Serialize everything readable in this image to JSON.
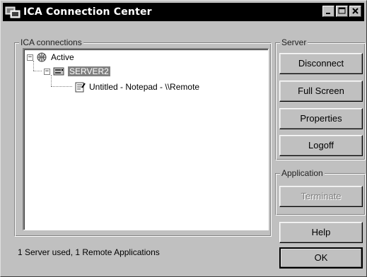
{
  "window": {
    "title": "ICA Connection Center",
    "controls": [
      "minimize-icon",
      "maximize-icon",
      "close-icon"
    ]
  },
  "connections_group": {
    "label": "ICA connections",
    "tree": {
      "root": {
        "label": "Active",
        "expander": "−",
        "icon": "network-icon"
      },
      "server": {
        "label": "SERVER2",
        "expander": "−",
        "icon": "server-icon",
        "selected": true
      },
      "app": {
        "label": "Untitled - Notepad - \\\\Remote",
        "icon": "notepad-icon"
      }
    }
  },
  "server_group": {
    "label": "Server",
    "buttons": {
      "disconnect": "Disconnect",
      "full_screen": "Full Screen",
      "properties": "Properties",
      "logoff": "Logoff"
    }
  },
  "application_group": {
    "label": "Application",
    "buttons": {
      "terminate": "Terminate"
    }
  },
  "footer": {
    "status": "1 Server used, 1 Remote Applications",
    "help": "Help",
    "ok": "OK"
  },
  "colors": {
    "face": "#c0c0c0",
    "titlebar": "#000000",
    "selection": "#808080"
  }
}
